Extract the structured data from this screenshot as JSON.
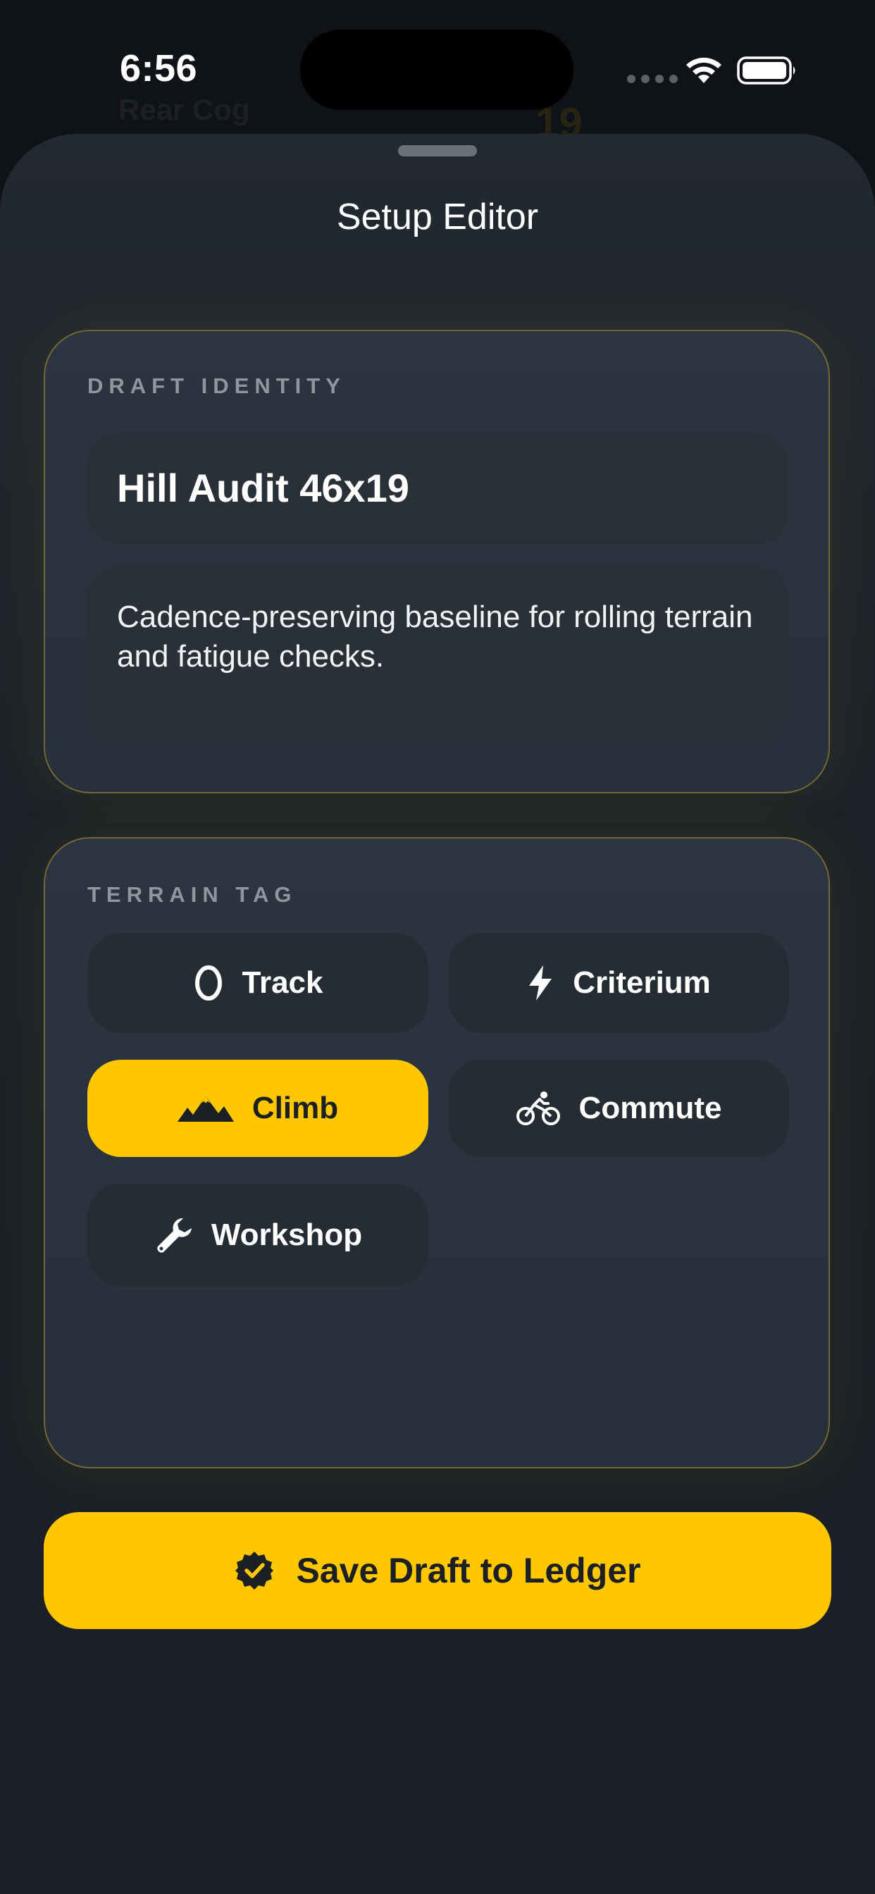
{
  "status_bar": {
    "time": "6:56"
  },
  "background": {
    "hint_label": "Rear Cog",
    "hint_value": "19"
  },
  "sheet": {
    "title": "Setup Editor"
  },
  "identity": {
    "section_label": "DRAFT IDENTITY",
    "name_value": "Hill Audit 46x19",
    "description_value": "Cadence-preserving baseline for rolling terrain and fatigue checks."
  },
  "terrain": {
    "section_label": "TERRAIN TAG",
    "options": [
      {
        "label": "Track",
        "icon": "oval-track-icon",
        "selected": false
      },
      {
        "label": "Criterium",
        "icon": "lightning-bolt-icon",
        "selected": false
      },
      {
        "label": "Climb",
        "icon": "mountains-icon",
        "selected": true
      },
      {
        "label": "Commute",
        "icon": "cyclist-icon",
        "selected": false
      },
      {
        "label": "Workshop",
        "icon": "wrench-icon",
        "selected": false
      }
    ]
  },
  "actions": {
    "save_label": "Save Draft to Ledger",
    "save_icon": "check-badge-icon"
  },
  "colors": {
    "accent": "#ffc700",
    "card_border": "#c9aa28",
    "sheet_bg": "#1d2228",
    "field_bg": "#2a3038"
  }
}
